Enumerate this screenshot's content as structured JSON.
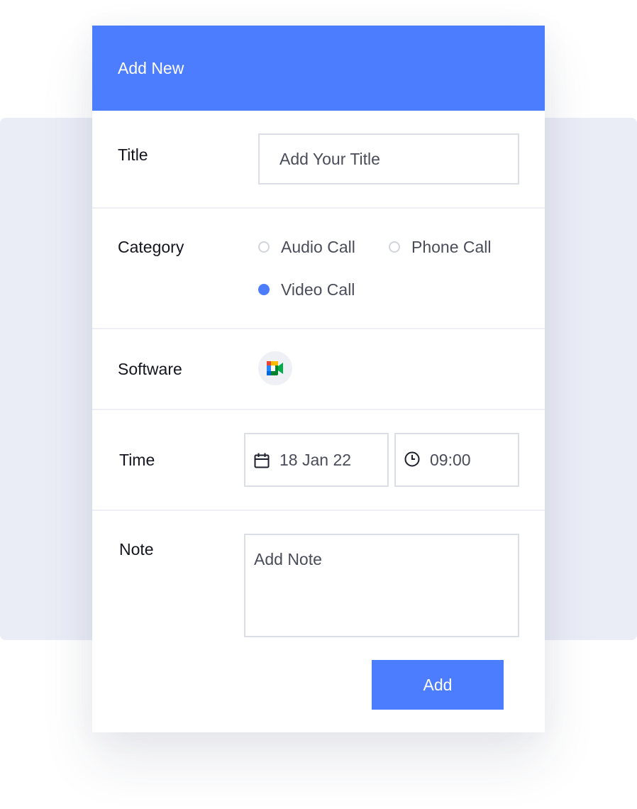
{
  "header": {
    "title": "Add New"
  },
  "form": {
    "title": {
      "label": "Title",
      "placeholder": "Add Your Title"
    },
    "category": {
      "label": "Category",
      "options": [
        {
          "label": "Audio Call",
          "selected": false
        },
        {
          "label": "Phone Call",
          "selected": false
        },
        {
          "label": "Video Call",
          "selected": true
        }
      ]
    },
    "software": {
      "label": "Software",
      "icon": "google-meet-icon"
    },
    "time": {
      "label": "Time",
      "date": "18 Jan 22",
      "time": "09:00"
    },
    "note": {
      "label": "Note",
      "placeholder": "Add Note"
    }
  },
  "actions": {
    "add_label": "Add"
  },
  "colors": {
    "accent": "#4d7dff",
    "backdrop": "#eaedf6",
    "border": "#dcdee6"
  }
}
